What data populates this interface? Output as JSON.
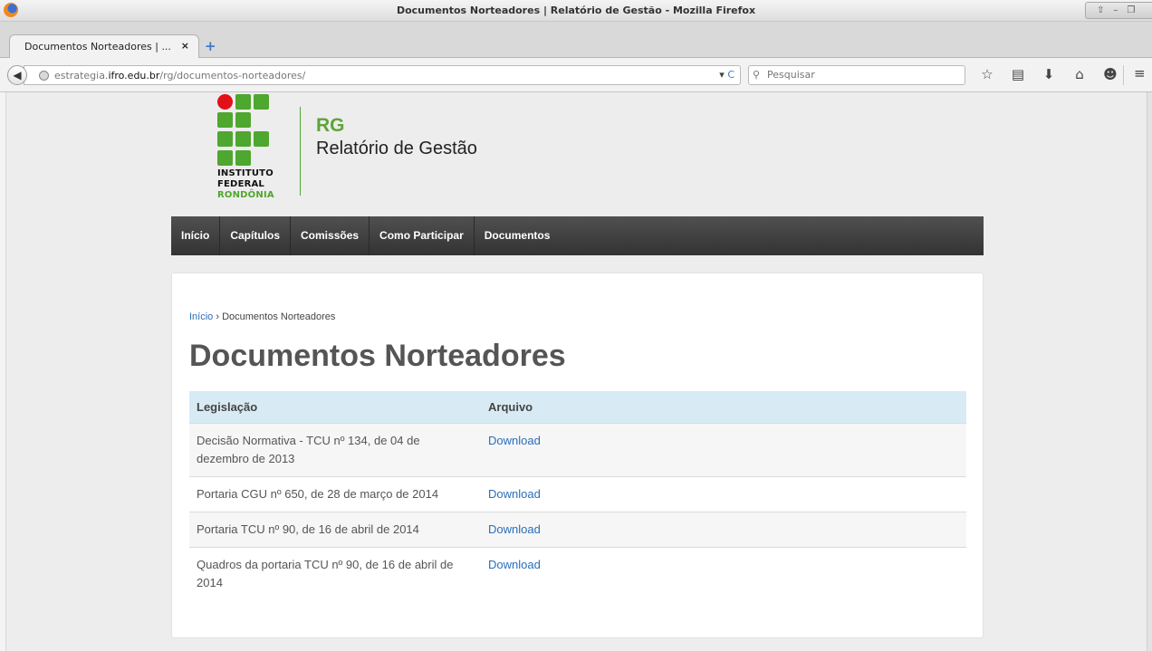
{
  "window": {
    "title": "Documentos Norteadores | Relatório de Gestão - Mozilla Firefox"
  },
  "tab": {
    "title": "Documentos Norteadores | ...",
    "close": "×",
    "new_tab": "+"
  },
  "navbar": {
    "url_prefix": "estrategia.",
    "url_domain": "ifro.edu.br",
    "url_path": "/rg/documentos-norteadores/",
    "url_dropdown": "▾",
    "reload": "C",
    "search_placeholder": "Pesquisar",
    "icons": [
      "star-icon",
      "reading-list-icon",
      "download-icon",
      "home-icon",
      "chat-icon",
      "menu-icon"
    ]
  },
  "logo": {
    "line1": "INSTITUTO",
    "line2": "FEDERAL",
    "line3": "RONDÔNIA"
  },
  "site": {
    "abbr": "RG",
    "name": "Relatório de Gestão"
  },
  "menu": {
    "items": [
      {
        "label": "Início"
      },
      {
        "label": "Capítulos"
      },
      {
        "label": "Comissões"
      },
      {
        "label": "Como Participar"
      },
      {
        "label": "Documentos"
      }
    ]
  },
  "breadcrumb": {
    "home": "Início",
    "separator": " › ",
    "current": "Documentos Norteadores"
  },
  "page": {
    "title": "Documentos Norteadores"
  },
  "table": {
    "headers": [
      "Legislação",
      "Arquivo"
    ],
    "rows": [
      {
        "legislacao": "Decisão Normativa - TCU nº 134, de 04 de dezembro de 2013",
        "arquivo": "Download"
      },
      {
        "legislacao": "Portaria CGU nº 650, de 28 de março de 2014",
        "arquivo": "Download"
      },
      {
        "legislacao": "Portaria TCU nº 90, de 16 de abril de 2014",
        "arquivo": "Download"
      },
      {
        "legislacao": "Quadros da portaria TCU nº 90, de 16 de abril de 2014",
        "arquivo": "Download"
      }
    ]
  },
  "colors": {
    "brand_green": "#4ea72e",
    "brand_red": "#e3101a",
    "link": "#2a6ebb",
    "nav_bg": "#3f3f3f",
    "table_header_bg": "#d8ebf5"
  }
}
